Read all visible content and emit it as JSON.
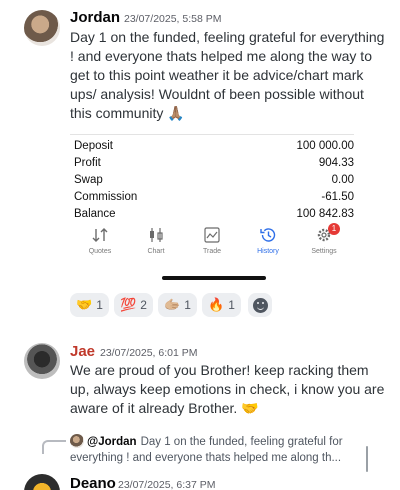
{
  "messages": [
    {
      "author": "Jordan",
      "timestamp": "23/07/2025, 5:58 PM",
      "text": "Day 1 on the funded, feeling grateful for everything ! and everyone thats helped me along the way to get to this point weather it be advice/chart mark ups/ analysis! Wouldnt of been possible without this community 🙏🏽"
    },
    {
      "author": "Jae",
      "timestamp": "23/07/2025, 6:01 PM",
      "text": "We are proud of you Brother! keep racking them up, always keep emotions in check, i know you are aware of it already Brother. 🤝"
    },
    {
      "author": "Deano",
      "timestamp": "23/07/2025, 6:37 PM"
    }
  ],
  "attachment": {
    "rows": [
      {
        "label": "Deposit",
        "value": "100 000.00"
      },
      {
        "label": "Profit",
        "value": "904.33"
      },
      {
        "label": "Swap",
        "value": "0.00"
      },
      {
        "label": "Commission",
        "value": "-61.50"
      },
      {
        "label": "Balance",
        "value": "100 842.83"
      }
    ],
    "tabs": [
      {
        "label": "Quotes",
        "icon": "quotes-icon"
      },
      {
        "label": "Chart",
        "icon": "candlestick-icon"
      },
      {
        "label": "Trade",
        "icon": "trade-chart-icon"
      },
      {
        "label": "History",
        "icon": "history-clock-icon",
        "active": true
      },
      {
        "label": "Settings",
        "icon": "gear-icon",
        "badge": "1"
      }
    ],
    "active_color": "#2f6fe8"
  },
  "reactions": [
    {
      "emoji": "🤝",
      "count": "1"
    },
    {
      "emoji": "💯",
      "count": "2"
    },
    {
      "emoji": "🫱🏼",
      "count": "1"
    },
    {
      "emoji": "🔥",
      "count": "1"
    }
  ],
  "reply": {
    "mention": "@Jordan",
    "text": "Day 1 on the funded, feeling grateful for everything ! and everyone thats helped me along th..."
  }
}
